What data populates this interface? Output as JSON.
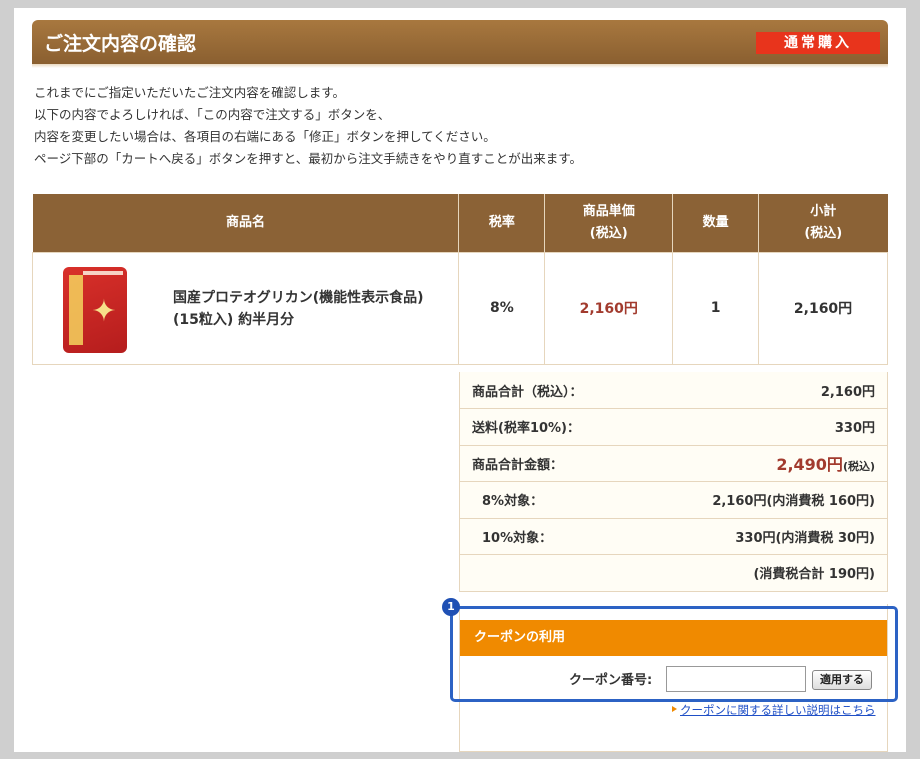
{
  "header": {
    "title": "ご注文内容の確認",
    "badge": "通常購入"
  },
  "intro": [
    "これまでにご指定いただいたご注文内容を確認します。",
    "以下の内容でよろしければ、「この内容で注文する」ボタンを、",
    "内容を変更したい場合は、各項目の右端にある「修正」ボタンを押してください。",
    "ページ下部の「カートへ戻る」ボタンを押すと、最初から注文手続きをやり直すことが出来ます。"
  ],
  "cart": {
    "headers": {
      "name": "商品名",
      "tax": "税率",
      "price_1": "商品単価",
      "price_2": "(税込)",
      "qty": "数量",
      "subtotal_1": "小計",
      "subtotal_2": "(税込)"
    },
    "item": {
      "name_1": "国産プロテオグリカン(機能性表示食品)",
      "name_2": "(15粒入) 約半月分",
      "tax": "8%",
      "price": "2,160円",
      "qty": "1",
      "subtotal": "2,160円",
      "image_icon": "product-package-icon"
    }
  },
  "summary": {
    "goods_total_label": "商品合計（税込）：",
    "goods_total_value": "2,160円",
    "shipping_label": "送料(税率10%)：",
    "shipping_value": "330円",
    "grand_total_label": "商品合計金額：",
    "grand_total_value": "2,490円",
    "grand_total_suffix": "(税込)",
    "tax8_label": "8%対象：",
    "tax8_value": "2,160円(内消費税 160円)",
    "tax10_label": "10%対象：",
    "tax10_value": "330円(内消費税 30円)",
    "tax_total": "(消費税合計 190円)"
  },
  "coupon": {
    "title": "クーポンの利用",
    "label": "クーポン番号:",
    "input_value": "",
    "apply_button": "適用する",
    "help_link": "クーポンに関する詳しい説明はこちら"
  },
  "annotation": {
    "marker": "1"
  },
  "colors": {
    "header_brown": "#8b6236",
    "badge_red": "#e8341c",
    "coupon_orange": "#f08a00",
    "price_red": "#a23b2e",
    "highlight_blue": "#2c62c4"
  }
}
